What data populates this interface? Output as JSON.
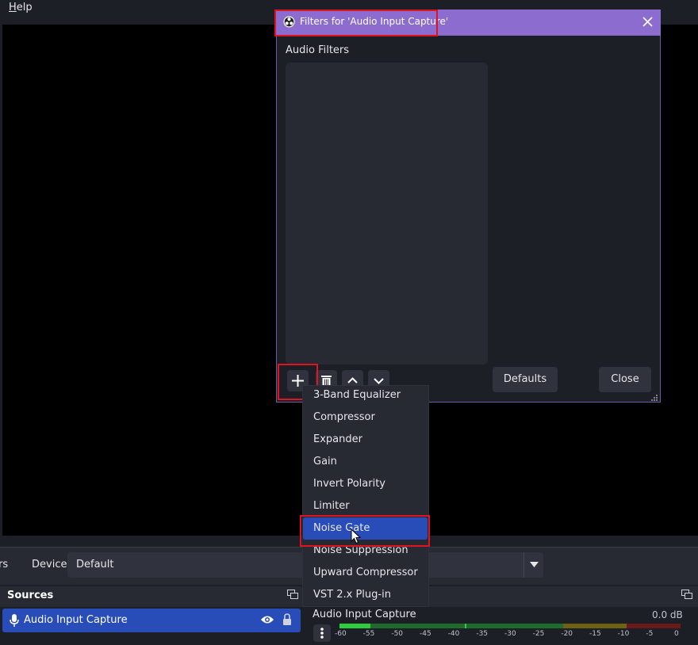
{
  "menubar": {
    "help": "Help"
  },
  "properties": {
    "left_fragment": "rs",
    "device_label": "Device",
    "device_value": "Default"
  },
  "sources": {
    "title": "Sources",
    "items": [
      {
        "label": "Audio Input Capture"
      }
    ]
  },
  "mixer": {
    "source_name": "Audio Input Capture",
    "level_db": "0.0 dB",
    "meter_ticks": [
      "-60",
      "-55",
      "-50",
      "-45",
      "-40",
      "-35",
      "-30",
      "-25",
      "-20",
      "-15",
      "-10",
      "-5",
      "0"
    ],
    "meter_level_fraction": 0.09
  },
  "dialog": {
    "title": "Filters for 'Audio Input Capture'",
    "section_label": "Audio Filters",
    "defaults_label": "Defaults",
    "close_label": "Close"
  },
  "filter_menu": {
    "items": [
      "3-Band Equalizer",
      "Compressor",
      "Expander",
      "Gain",
      "Invert Polarity",
      "Limiter",
      "Noise Gate",
      "Noise Suppression",
      "Upward Compressor",
      "VST 2.x Plug-in"
    ],
    "selected": "Noise Gate"
  },
  "colors": {
    "accent": "#284cb8",
    "titlebar": "#8c6ccf",
    "highlight": "#e0141e",
    "meter_green": "#1f9e3a",
    "meter_yellow": "#8a7a12",
    "meter_red": "#7a1a1a"
  }
}
